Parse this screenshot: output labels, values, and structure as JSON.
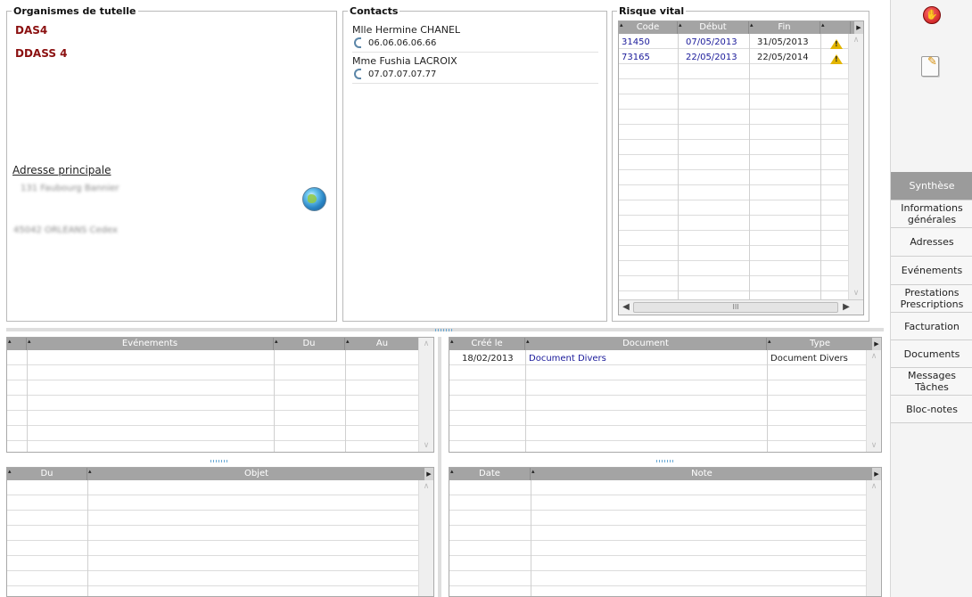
{
  "organismes": {
    "title": "Organismes de tutelle",
    "items": [
      "DAS4",
      "DDASS 4"
    ],
    "adresse_title": "Adresse principale",
    "adresse_line1": "131 Faubourg Bannier",
    "adresse_line2": "45042 ORLEANS Cedex"
  },
  "contacts": {
    "title": "Contacts",
    "items": [
      {
        "name": "Mlle Hermine CHANEL",
        "phone": "06.06.06.06.66"
      },
      {
        "name": "Mme Fushia LACROIX",
        "phone": "07.07.07.07.77"
      }
    ]
  },
  "risque": {
    "title": "Risque vital",
    "columns": [
      "Code",
      "Début",
      "Fin"
    ],
    "rows": [
      {
        "code": "31450",
        "debut": "07/05/2013",
        "fin": "31/05/2013"
      },
      {
        "code": "73165",
        "debut": "22/05/2013",
        "fin": "22/05/2014"
      }
    ],
    "hscroll_thumb": "III"
  },
  "evenements": {
    "columns": [
      "Evénements",
      "Du",
      "Au"
    ]
  },
  "documents": {
    "columns": [
      "Créé le",
      "Document",
      "Type"
    ],
    "rows": [
      {
        "cree_le": "18/02/2013",
        "document": "Document Divers",
        "type": "Document Divers"
      }
    ]
  },
  "objets": {
    "columns": [
      "Du",
      "Objet"
    ]
  },
  "notes": {
    "columns": [
      "Date",
      "Note"
    ]
  },
  "sidebar": {
    "stop_icon": "hand-stop-icon",
    "note_icon": "edit-note-icon",
    "items": [
      {
        "label": "Synthèse",
        "active": true
      },
      {
        "label": "Informations\ngénérales"
      },
      {
        "label": "Adresses"
      },
      {
        "label": "Evénements"
      },
      {
        "label": "Prestations\nPrescriptions"
      },
      {
        "label": "Facturation"
      },
      {
        "label": "Documents"
      },
      {
        "label": "Messages\nTâches"
      },
      {
        "label": "Bloc-notes"
      }
    ]
  },
  "colors": {
    "accent_dark_red": "#8b1010",
    "link_blue": "#1a1a9a",
    "header_gray": "#a4a4a4",
    "active_nav": "#9b9b9b"
  }
}
